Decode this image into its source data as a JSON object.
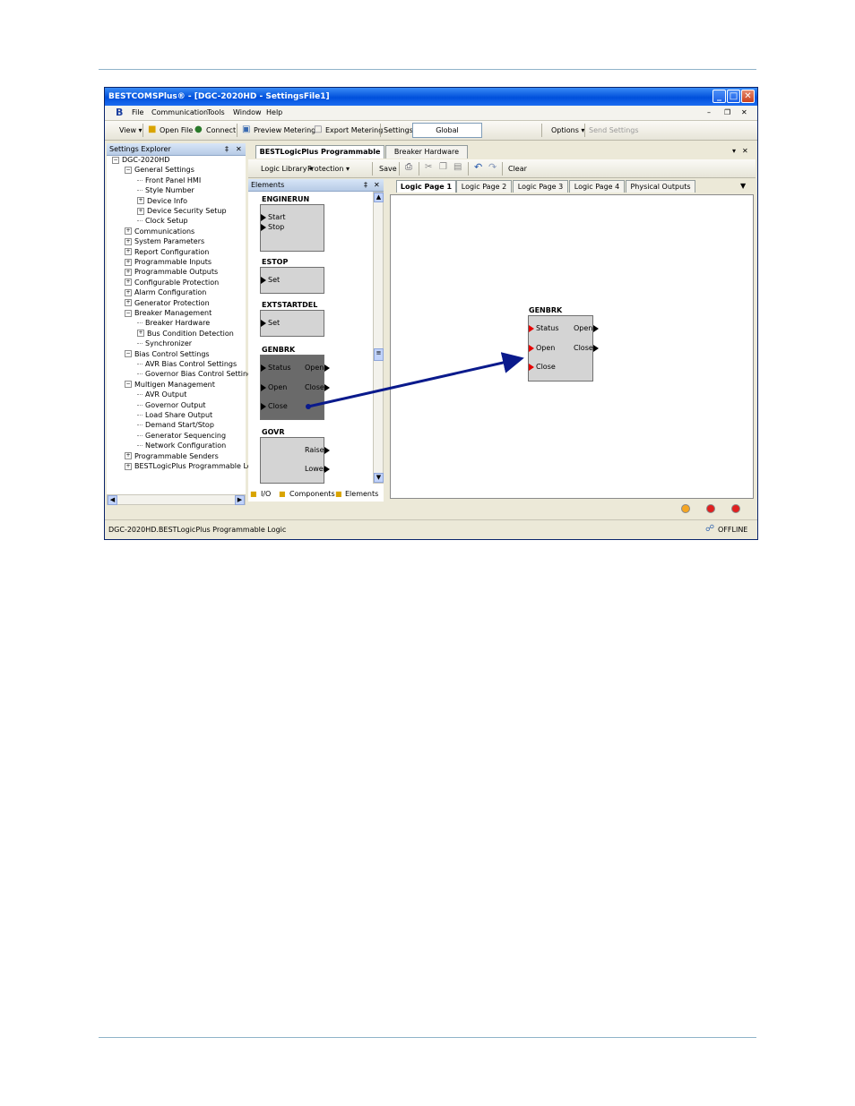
{
  "window": {
    "title": "BESTCOMSPlus® - [DGC-2020HD - SettingsFile1]",
    "min_glyph": "_",
    "max_glyph": "□",
    "close_glyph": "✕"
  },
  "menu": {
    "items": [
      "File",
      "Communication",
      "Tools",
      "Window",
      "Help"
    ],
    "mdi_min": "–",
    "mdi_restore": "❐",
    "mdi_close": "✕"
  },
  "toolbar": {
    "view": "View ▾",
    "open_file": "Open File",
    "connect": "Connect",
    "preview_metering": "Preview Metering",
    "export_metering": "Export Metering",
    "settings": "Settings",
    "global": "Global",
    "options": "Options ▾",
    "send_settings": "Send Settings"
  },
  "settings_explorer": {
    "title": "Settings Explorer",
    "pin": "‡",
    "close": "✕",
    "tree": [
      {
        "label": "DGC-2020HD",
        "level": 0,
        "exp": "−"
      },
      {
        "label": "General Settings",
        "level": 1,
        "exp": "−"
      },
      {
        "label": "Front Panel HMI",
        "level": 2,
        "exp": ""
      },
      {
        "label": "Style Number",
        "level": 2,
        "exp": ""
      },
      {
        "label": "Device Info",
        "level": 2,
        "exp": "+"
      },
      {
        "label": "Device Security Setup",
        "level": 2,
        "exp": "+"
      },
      {
        "label": "Clock Setup",
        "level": 2,
        "exp": ""
      },
      {
        "label": "Communications",
        "level": 1,
        "exp": "+"
      },
      {
        "label": "System Parameters",
        "level": 1,
        "exp": "+"
      },
      {
        "label": "Report Configuration",
        "level": 1,
        "exp": "+"
      },
      {
        "label": "Programmable Inputs",
        "level": 1,
        "exp": "+"
      },
      {
        "label": "Programmable Outputs",
        "level": 1,
        "exp": "+"
      },
      {
        "label": "Configurable Protection",
        "level": 1,
        "exp": "+"
      },
      {
        "label": "Alarm Configuration",
        "level": 1,
        "exp": "+"
      },
      {
        "label": "Generator Protection",
        "level": 1,
        "exp": "+"
      },
      {
        "label": "Breaker Management",
        "level": 1,
        "exp": "−"
      },
      {
        "label": "Breaker Hardware",
        "level": 2,
        "exp": ""
      },
      {
        "label": "Bus Condition Detection",
        "level": 2,
        "exp": "+"
      },
      {
        "label": "Synchronizer",
        "level": 2,
        "exp": ""
      },
      {
        "label": "Bias Control Settings",
        "level": 1,
        "exp": "−"
      },
      {
        "label": "AVR Bias Control Settings",
        "level": 2,
        "exp": ""
      },
      {
        "label": "Governor Bias Control Settings",
        "level": 2,
        "exp": ""
      },
      {
        "label": "Multigen Management",
        "level": 1,
        "exp": "−"
      },
      {
        "label": "AVR Output",
        "level": 2,
        "exp": ""
      },
      {
        "label": "Governor Output",
        "level": 2,
        "exp": ""
      },
      {
        "label": "Load Share Output",
        "level": 2,
        "exp": ""
      },
      {
        "label": "Demand Start/Stop",
        "level": 2,
        "exp": ""
      },
      {
        "label": "Generator Sequencing",
        "level": 2,
        "exp": ""
      },
      {
        "label": "Network Configuration",
        "level": 2,
        "exp": ""
      },
      {
        "label": "Programmable Senders",
        "level": 1,
        "exp": "+"
      },
      {
        "label": "BESTLogicPlus Programmable Logic",
        "level": 1,
        "exp": "+"
      }
    ]
  },
  "doc_tabs": {
    "tab1": "BESTLogicPlus Programmable ...",
    "tab2": "Breaker Hardware",
    "menu": "▾",
    "close": "✕"
  },
  "logic_toolbar": {
    "library": "Logic Library ▾",
    "protection": "Protection ▾",
    "save": "Save",
    "clear": "Clear"
  },
  "elements_panel": {
    "title": "Elements",
    "pin": "‡",
    "close": "✕",
    "blocks": {
      "enginerun": {
        "name": "ENGINERUN",
        "ports": [
          "Start",
          "Stop"
        ]
      },
      "estop": {
        "name": "ESTOP",
        "ports": [
          "Set"
        ]
      },
      "extstartdel": {
        "name": "EXTSTARTDEL",
        "ports": [
          "Set"
        ]
      },
      "genbrk": {
        "name": "GENBRK",
        "inputs": [
          "Status",
          "Open",
          "Close"
        ],
        "outputs": [
          "Open",
          "Close"
        ]
      },
      "govr": {
        "name": "GOVR",
        "outputs": [
          "Raise",
          "Lower"
        ]
      }
    },
    "bottom_tabs": [
      "I/O",
      "Components",
      "Elements"
    ]
  },
  "logic_pages": {
    "tabs": [
      "Logic Page 1",
      "Logic Page 2",
      "Logic Page 3",
      "Logic Page 4",
      "Physical Outputs"
    ],
    "menu": "▼"
  },
  "canvas": {
    "genbrk": {
      "name": "GENBRK",
      "inputs": [
        "Status",
        "Open",
        "Close"
      ],
      "outputs": [
        "Open",
        "Close"
      ]
    },
    "arrow_color": "#0a1a8c"
  },
  "status": {
    "path": "DGC-2020HD.BESTLogicPlus Programmable Logic",
    "connection": "OFFLINE",
    "colors": [
      "#f5a623",
      "#e02020",
      "#e02020"
    ]
  }
}
